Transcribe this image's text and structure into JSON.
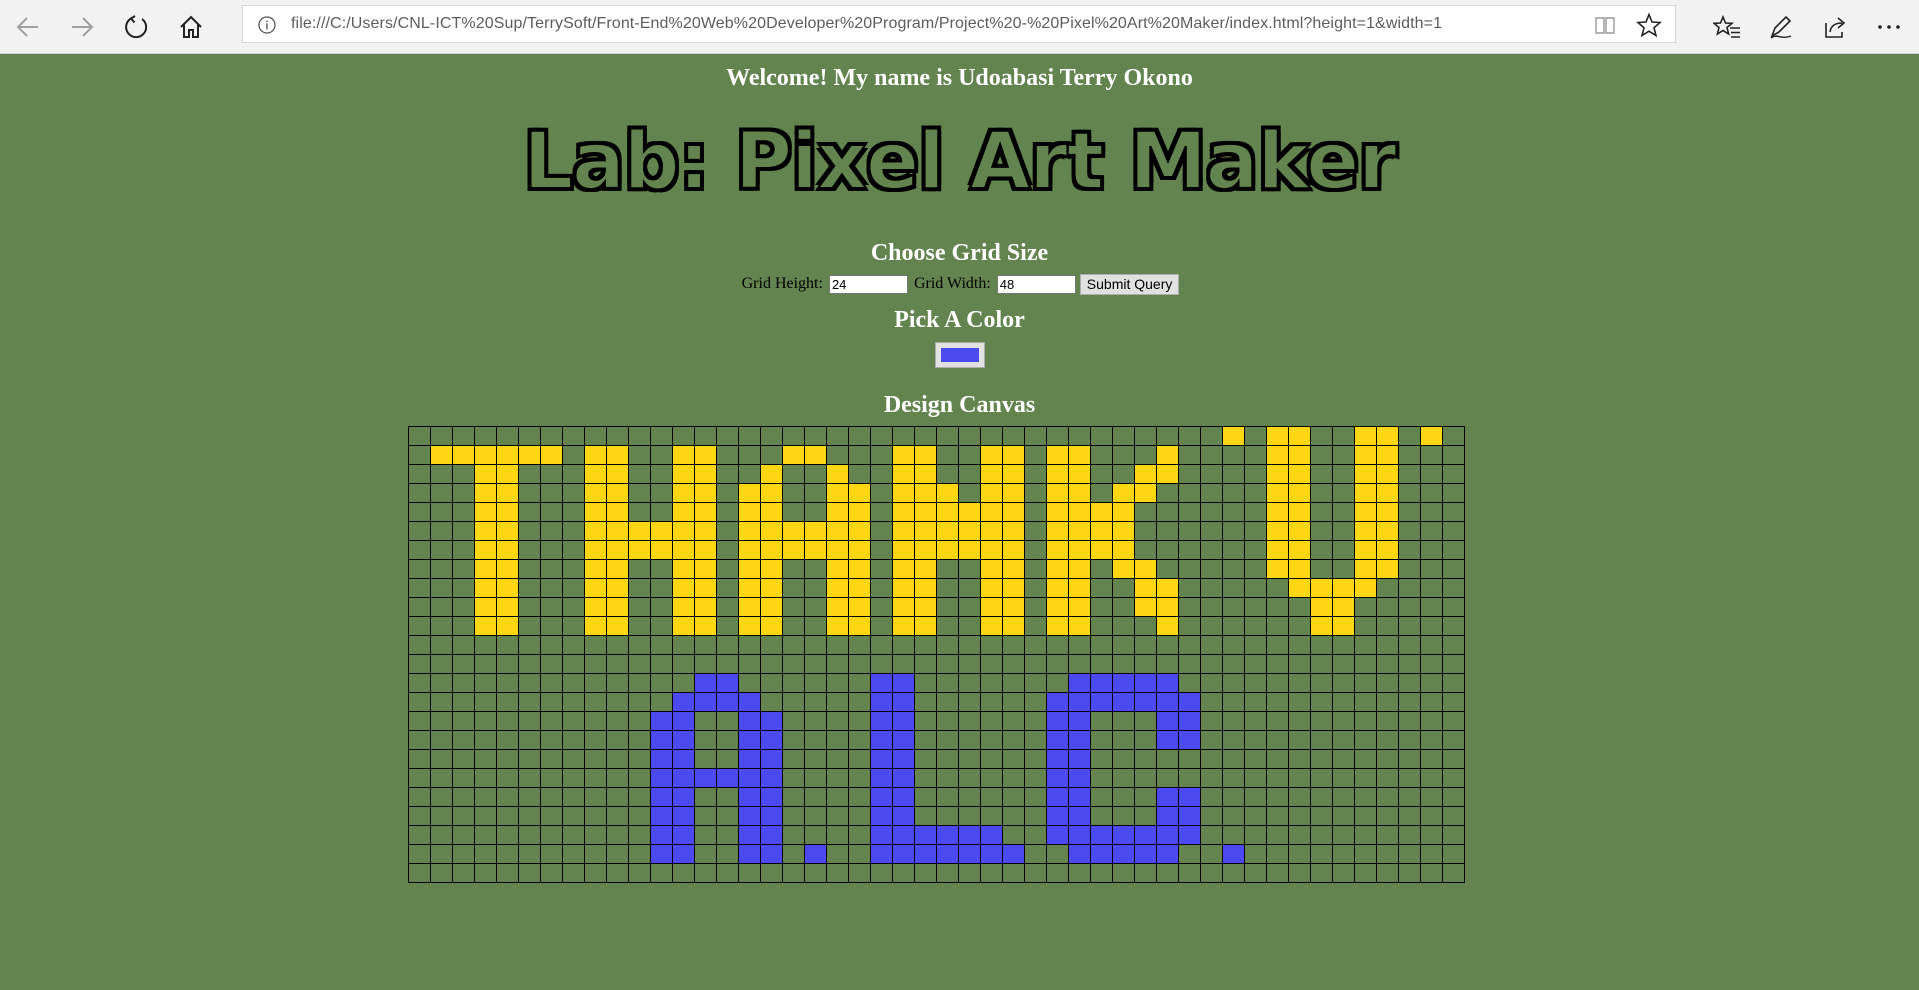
{
  "browser": {
    "url": "file:///C:/Users/CNL-ICT%20Sup/TerrySoft/Front-End%20Web%20Developer%20Program/Project%20-%20Pixel%20Art%20Maker/index.html?height=1&width=1"
  },
  "page": {
    "welcome": "Welcome! My name is Udoabasi Terry Okono",
    "title": "Lab: Pixel Art Maker",
    "grid_heading": "Choose Grid Size",
    "height_label": "Grid Height:",
    "height_value": "24",
    "width_label": "Grid Width:",
    "width_value": "48",
    "submit_label": "Submit Query",
    "color_heading": "Pick A Color",
    "selected_color": "#4a4af0",
    "canvas_heading": "Design Canvas"
  },
  "colors": {
    "background": "#63834f",
    "yellow": "#ffd613",
    "blue": "#4a4af0"
  },
  "canvas": {
    "rows": 24,
    "cols": 48,
    "yellow_cells": [
      [
        0,
        37
      ],
      [
        0,
        39
      ],
      [
        0,
        40
      ],
      [
        0,
        43
      ],
      [
        0,
        44
      ],
      [
        0,
        46
      ],
      [
        1,
        1
      ],
      [
        1,
        2
      ],
      [
        1,
        3
      ],
      [
        1,
        4
      ],
      [
        1,
        5
      ],
      [
        1,
        6
      ],
      [
        1,
        8
      ],
      [
        1,
        9
      ],
      [
        1,
        12
      ],
      [
        1,
        13
      ],
      [
        1,
        17
      ],
      [
        1,
        18
      ],
      [
        1,
        22
      ],
      [
        1,
        23
      ],
      [
        1,
        26
      ],
      [
        1,
        27
      ],
      [
        1,
        29
      ],
      [
        1,
        30
      ],
      [
        1,
        34
      ],
      [
        1,
        39
      ],
      [
        1,
        40
      ],
      [
        1,
        43
      ],
      [
        1,
        44
      ],
      [
        2,
        3
      ],
      [
        2,
        4
      ],
      [
        2,
        8
      ],
      [
        2,
        9
      ],
      [
        2,
        12
      ],
      [
        2,
        13
      ],
      [
        2,
        16
      ],
      [
        2,
        19
      ],
      [
        2,
        22
      ],
      [
        2,
        23
      ],
      [
        2,
        26
      ],
      [
        2,
        27
      ],
      [
        2,
        29
      ],
      [
        2,
        30
      ],
      [
        2,
        33
      ],
      [
        2,
        34
      ],
      [
        2,
        39
      ],
      [
        2,
        40
      ],
      [
        2,
        43
      ],
      [
        2,
        44
      ],
      [
        3,
        3
      ],
      [
        3,
        4
      ],
      [
        3,
        8
      ],
      [
        3,
        9
      ],
      [
        3,
        12
      ],
      [
        3,
        13
      ],
      [
        3,
        15
      ],
      [
        3,
        16
      ],
      [
        3,
        19
      ],
      [
        3,
        20
      ],
      [
        3,
        22
      ],
      [
        3,
        23
      ],
      [
        3,
        24
      ],
      [
        3,
        26
      ],
      [
        3,
        27
      ],
      [
        3,
        29
      ],
      [
        3,
        30
      ],
      [
        3,
        32
      ],
      [
        3,
        33
      ],
      [
        3,
        39
      ],
      [
        3,
        40
      ],
      [
        3,
        43
      ],
      [
        3,
        44
      ],
      [
        4,
        3
      ],
      [
        4,
        4
      ],
      [
        4,
        8
      ],
      [
        4,
        9
      ],
      [
        4,
        12
      ],
      [
        4,
        13
      ],
      [
        4,
        15
      ],
      [
        4,
        16
      ],
      [
        4,
        19
      ],
      [
        4,
        20
      ],
      [
        4,
        22
      ],
      [
        4,
        23
      ],
      [
        4,
        24
      ],
      [
        4,
        25
      ],
      [
        4,
        26
      ],
      [
        4,
        27
      ],
      [
        4,
        29
      ],
      [
        4,
        30
      ],
      [
        4,
        31
      ],
      [
        4,
        32
      ],
      [
        4,
        39
      ],
      [
        4,
        40
      ],
      [
        4,
        43
      ],
      [
        4,
        44
      ],
      [
        5,
        3
      ],
      [
        5,
        4
      ],
      [
        5,
        8
      ],
      [
        5,
        9
      ],
      [
        5,
        10
      ],
      [
        5,
        11
      ],
      [
        5,
        12
      ],
      [
        5,
        13
      ],
      [
        5,
        15
      ],
      [
        5,
        16
      ],
      [
        5,
        17
      ],
      [
        5,
        18
      ],
      [
        5,
        19
      ],
      [
        5,
        20
      ],
      [
        5,
        22
      ],
      [
        5,
        23
      ],
      [
        5,
        24
      ],
      [
        5,
        25
      ],
      [
        5,
        26
      ],
      [
        5,
        27
      ],
      [
        5,
        29
      ],
      [
        5,
        30
      ],
      [
        5,
        31
      ],
      [
        5,
        32
      ],
      [
        5,
        39
      ],
      [
        5,
        40
      ],
      [
        5,
        43
      ],
      [
        5,
        44
      ],
      [
        6,
        3
      ],
      [
        6,
        4
      ],
      [
        6,
        8
      ],
      [
        6,
        9
      ],
      [
        6,
        10
      ],
      [
        6,
        11
      ],
      [
        6,
        12
      ],
      [
        6,
        13
      ],
      [
        6,
        15
      ],
      [
        6,
        16
      ],
      [
        6,
        17
      ],
      [
        6,
        18
      ],
      [
        6,
        19
      ],
      [
        6,
        20
      ],
      [
        6,
        22
      ],
      [
        6,
        23
      ],
      [
        6,
        24
      ],
      [
        6,
        25
      ],
      [
        6,
        26
      ],
      [
        6,
        27
      ],
      [
        6,
        29
      ],
      [
        6,
        30
      ],
      [
        6,
        31
      ],
      [
        6,
        32
      ],
      [
        6,
        39
      ],
      [
        6,
        40
      ],
      [
        6,
        43
      ],
      [
        6,
        44
      ],
      [
        7,
        3
      ],
      [
        7,
        4
      ],
      [
        7,
        8
      ],
      [
        7,
        9
      ],
      [
        7,
        12
      ],
      [
        7,
        13
      ],
      [
        7,
        15
      ],
      [
        7,
        16
      ],
      [
        7,
        19
      ],
      [
        7,
        20
      ],
      [
        7,
        22
      ],
      [
        7,
        23
      ],
      [
        7,
        26
      ],
      [
        7,
        27
      ],
      [
        7,
        29
      ],
      [
        7,
        30
      ],
      [
        7,
        32
      ],
      [
        7,
        33
      ],
      [
        7,
        39
      ],
      [
        7,
        40
      ],
      [
        7,
        43
      ],
      [
        7,
        44
      ],
      [
        8,
        3
      ],
      [
        8,
        4
      ],
      [
        8,
        8
      ],
      [
        8,
        9
      ],
      [
        8,
        12
      ],
      [
        8,
        13
      ],
      [
        8,
        15
      ],
      [
        8,
        16
      ],
      [
        8,
        19
      ],
      [
        8,
        20
      ],
      [
        8,
        22
      ],
      [
        8,
        23
      ],
      [
        8,
        26
      ],
      [
        8,
        27
      ],
      [
        8,
        29
      ],
      [
        8,
        30
      ],
      [
        8,
        33
      ],
      [
        8,
        34
      ],
      [
        8,
        40
      ],
      [
        8,
        41
      ],
      [
        8,
        42
      ],
      [
        8,
        43
      ],
      [
        9,
        3
      ],
      [
        9,
        4
      ],
      [
        9,
        8
      ],
      [
        9,
        9
      ],
      [
        9,
        12
      ],
      [
        9,
        13
      ],
      [
        9,
        15
      ],
      [
        9,
        16
      ],
      [
        9,
        19
      ],
      [
        9,
        20
      ],
      [
        9,
        22
      ],
      [
        9,
        23
      ],
      [
        9,
        26
      ],
      [
        9,
        27
      ],
      [
        9,
        29
      ],
      [
        9,
        30
      ],
      [
        9,
        33
      ],
      [
        9,
        34
      ],
      [
        9,
        41
      ],
      [
        9,
        42
      ],
      [
        10,
        3
      ],
      [
        10,
        4
      ],
      [
        10,
        8
      ],
      [
        10,
        9
      ],
      [
        10,
        12
      ],
      [
        10,
        13
      ],
      [
        10,
        15
      ],
      [
        10,
        16
      ],
      [
        10,
        19
      ],
      [
        10,
        20
      ],
      [
        10,
        22
      ],
      [
        10,
        23
      ],
      [
        10,
        26
      ],
      [
        10,
        27
      ],
      [
        10,
        29
      ],
      [
        10,
        30
      ],
      [
        10,
        34
      ],
      [
        10,
        41
      ],
      [
        10,
        42
      ]
    ],
    "blue_cells": [
      [
        13,
        13
      ],
      [
        13,
        14
      ],
      [
        13,
        21
      ],
      [
        13,
        22
      ],
      [
        13,
        30
      ],
      [
        13,
        31
      ],
      [
        13,
        32
      ],
      [
        13,
        33
      ],
      [
        13,
        34
      ],
      [
        14,
        12
      ],
      [
        14,
        13
      ],
      [
        14,
        14
      ],
      [
        14,
        15
      ],
      [
        14,
        21
      ],
      [
        14,
        22
      ],
      [
        14,
        29
      ],
      [
        14,
        30
      ],
      [
        14,
        31
      ],
      [
        14,
        32
      ],
      [
        14,
        33
      ],
      [
        14,
        34
      ],
      [
        14,
        35
      ],
      [
        15,
        11
      ],
      [
        15,
        12
      ],
      [
        15,
        15
      ],
      [
        15,
        16
      ],
      [
        15,
        21
      ],
      [
        15,
        22
      ],
      [
        15,
        29
      ],
      [
        15,
        30
      ],
      [
        15,
        34
      ],
      [
        15,
        35
      ],
      [
        16,
        11
      ],
      [
        16,
        12
      ],
      [
        16,
        15
      ],
      [
        16,
        16
      ],
      [
        16,
        21
      ],
      [
        16,
        22
      ],
      [
        16,
        29
      ],
      [
        16,
        30
      ],
      [
        16,
        34
      ],
      [
        16,
        35
      ],
      [
        17,
        11
      ],
      [
        17,
        12
      ],
      [
        17,
        15
      ],
      [
        17,
        16
      ],
      [
        17,
        21
      ],
      [
        17,
        22
      ],
      [
        17,
        29
      ],
      [
        17,
        30
      ],
      [
        18,
        11
      ],
      [
        18,
        12
      ],
      [
        18,
        13
      ],
      [
        18,
        14
      ],
      [
        18,
        15
      ],
      [
        18,
        16
      ],
      [
        18,
        21
      ],
      [
        18,
        22
      ],
      [
        18,
        29
      ],
      [
        18,
        30
      ],
      [
        19,
        11
      ],
      [
        19,
        12
      ],
      [
        19,
        15
      ],
      [
        19,
        16
      ],
      [
        19,
        21
      ],
      [
        19,
        22
      ],
      [
        19,
        29
      ],
      [
        19,
        30
      ],
      [
        19,
        34
      ],
      [
        19,
        35
      ],
      [
        20,
        11
      ],
      [
        20,
        12
      ],
      [
        20,
        15
      ],
      [
        20,
        16
      ],
      [
        20,
        21
      ],
      [
        20,
        22
      ],
      [
        20,
        29
      ],
      [
        20,
        30
      ],
      [
        20,
        34
      ],
      [
        20,
        35
      ],
      [
        21,
        11
      ],
      [
        21,
        12
      ],
      [
        21,
        15
      ],
      [
        21,
        16
      ],
      [
        21,
        21
      ],
      [
        21,
        22
      ],
      [
        21,
        23
      ],
      [
        21,
        24
      ],
      [
        21,
        25
      ],
      [
        21,
        26
      ],
      [
        21,
        29
      ],
      [
        21,
        30
      ],
      [
        21,
        31
      ],
      [
        21,
        32
      ],
      [
        21,
        33
      ],
      [
        21,
        34
      ],
      [
        21,
        35
      ],
      [
        22,
        11
      ],
      [
        22,
        12
      ],
      [
        22,
        15
      ],
      [
        22,
        16
      ],
      [
        22,
        18
      ],
      [
        22,
        21
      ],
      [
        22,
        22
      ],
      [
        22,
        23
      ],
      [
        22,
        24
      ],
      [
        22,
        25
      ],
      [
        22,
        26
      ],
      [
        22,
        27
      ],
      [
        22,
        30
      ],
      [
        22,
        31
      ],
      [
        22,
        32
      ],
      [
        22,
        33
      ],
      [
        22,
        34
      ],
      [
        22,
        37
      ]
    ]
  }
}
